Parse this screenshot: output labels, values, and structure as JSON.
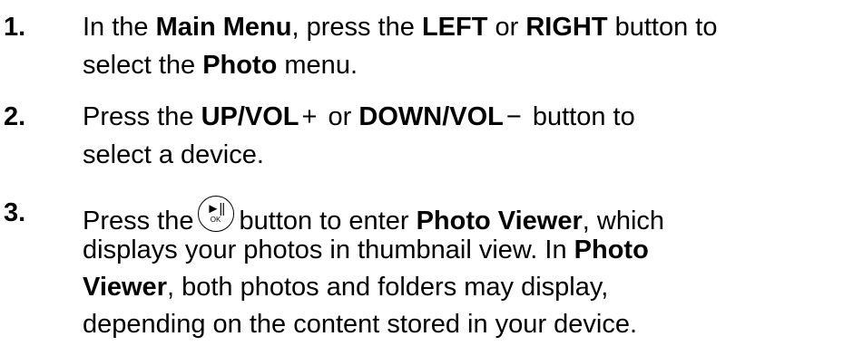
{
  "steps": [
    {
      "number": "1.",
      "line1": {
        "t1": "In the ",
        "b1": "Main Menu",
        "t2": ", press the ",
        "b2": "LEFT",
        "t3": " or ",
        "b3": "RIGHT",
        "t4": " button to"
      },
      "line2": {
        "t1": "select the ",
        "b1": "Photo",
        "t2": " menu."
      }
    },
    {
      "number": "2.",
      "line1": {
        "t1": "Press the ",
        "b1": "UP/VOL",
        "s1": "+",
        "t2": " or ",
        "b2": "DOWN/VOL",
        "s2": "−",
        "t3": " button to"
      },
      "line2": {
        "t1": "select a device."
      }
    },
    {
      "number": "3.",
      "line1": {
        "t1": "Press the",
        "icon_play": "►||",
        "icon_ok": "OK",
        "t2": "button to enter ",
        "b1": "Photo Viewer",
        "t3": ", which"
      },
      "line2": {
        "t1": "displays your photos in thumbnail view. In ",
        "b1": "Photo"
      },
      "line3": {
        "b1": "Viewer",
        "t1": ", both photos and folders may display,"
      },
      "line4": {
        "t1": "depending on the content stored in your device."
      }
    }
  ]
}
